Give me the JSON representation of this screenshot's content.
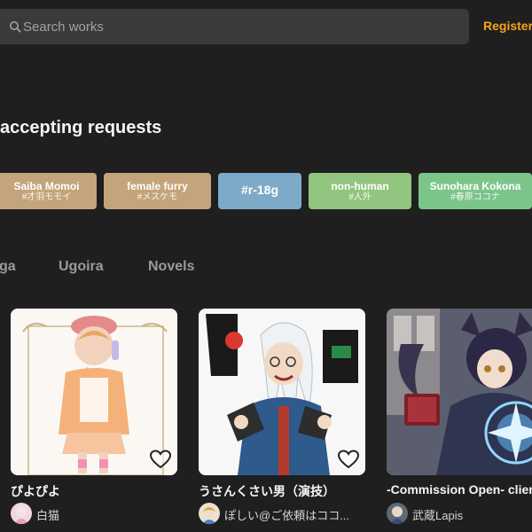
{
  "search": {
    "placeholder": "Search works"
  },
  "header": {
    "register_label": "Register"
  },
  "section": {
    "title": "accepting requests"
  },
  "tags": [
    {
      "name": "Saiba Momoi",
      "sub": "#才羽モモイ",
      "color": "#c4a47a"
    },
    {
      "name": "female furry",
      "sub": "#メスケモ",
      "color": "#c4a47a"
    },
    {
      "name": "#r-18g",
      "sub": "",
      "color": "#7eaac9"
    },
    {
      "name": "non-human",
      "sub": "#人外",
      "color": "#92c57f"
    },
    {
      "name": "Sunohara Kokona",
      "sub": "#春原ココナ",
      "color": "#7cc58a"
    }
  ],
  "tabs": [
    "ga",
    "Ugoira",
    "Novels"
  ],
  "works": [
    {
      "title": "ぴよぴよ",
      "author": "白猫",
      "liked": false
    },
    {
      "title": "うさんくさい男（演技）",
      "author": "ぽしい@ご依頼はココ...",
      "liked": false
    },
    {
      "title": "-Commission Open- clien",
      "author": "武蔵Lapis",
      "liked": false
    }
  ],
  "colors": {
    "accent": "#f6a317",
    "background": "#1f1f1f",
    "search_bg": "#3a3a3a"
  },
  "icons": {
    "search": "search-icon",
    "like": "heart-icon"
  }
}
